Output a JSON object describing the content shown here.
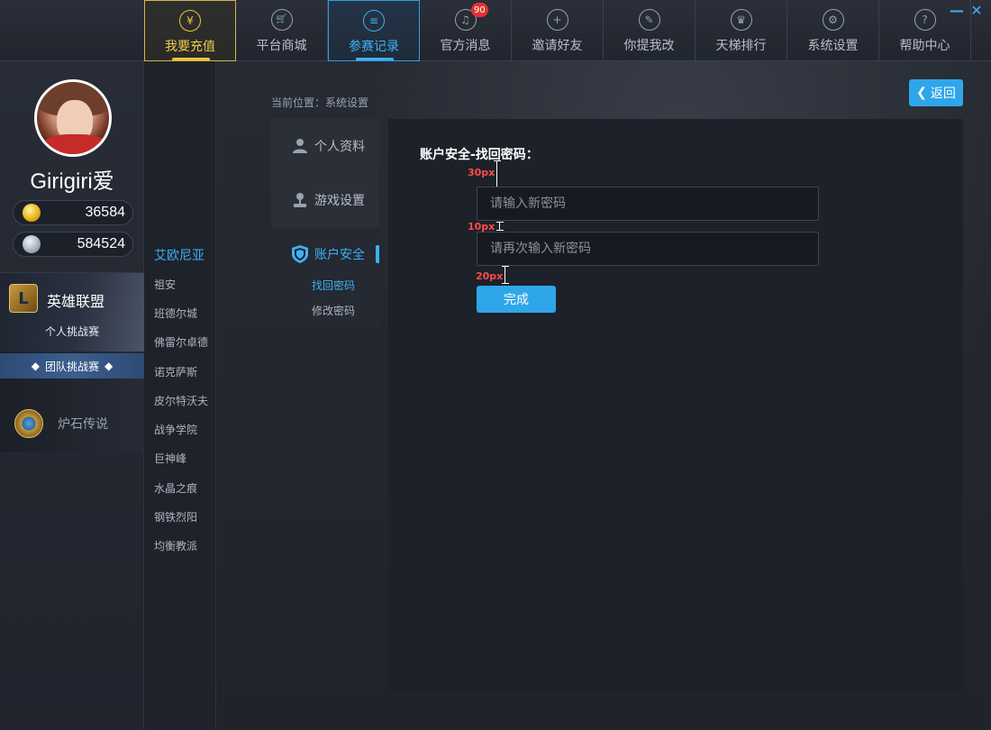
{
  "window": {
    "minimize_icon": "minus-icon",
    "close_icon": "close-icon",
    "minimize_glyph": "—",
    "close_glyph": "✕"
  },
  "nav": {
    "items": [
      {
        "label": "我要充值",
        "icon": "yuan-icon",
        "glyph": "¥"
      },
      {
        "label": "平台商城",
        "icon": "cart-icon",
        "glyph": "🛒"
      },
      {
        "label": "参赛记录",
        "icon": "document-icon",
        "glyph": "≡"
      },
      {
        "label": "官方消息",
        "icon": "bell-icon",
        "glyph": "♫",
        "badge": "90"
      },
      {
        "label": "邀请好友",
        "icon": "add-user-icon",
        "glyph": "+"
      },
      {
        "label": "你提我改",
        "icon": "pencil-icon",
        "glyph": "✎"
      },
      {
        "label": "天梯排行",
        "icon": "trophy-icon",
        "glyph": "♛"
      },
      {
        "label": "系统设置",
        "icon": "gear-icon",
        "glyph": "⚙"
      },
      {
        "label": "帮助中心",
        "icon": "question-icon",
        "glyph": "?"
      }
    ]
  },
  "profile": {
    "username": "Girigiri爱",
    "gold": "36584",
    "silver": "584524"
  },
  "games": {
    "lol": {
      "logo_text": "L",
      "title": "英雄联盟",
      "mode": "个人挑战赛",
      "team_mode": "团队挑战赛"
    },
    "hearthstone": {
      "title": "炉石传说"
    }
  },
  "servers": [
    "艾欧尼亚",
    "祖安",
    "班德尔城",
    "佛雷尔卓德",
    "诺克萨斯",
    "皮尔特沃夫",
    "战争学院",
    "巨神峰",
    "水晶之痕",
    "钢铁烈阳",
    "均衡教派"
  ],
  "breadcrumb": "当前位置：系统设置",
  "back_button": {
    "label": "返回",
    "glyph": "❮"
  },
  "settings_menu": {
    "items": [
      {
        "label": "个人资料",
        "icon": "user-icon"
      },
      {
        "label": "游戏设置",
        "icon": "joystick-icon"
      },
      {
        "label": "账户安全",
        "icon": "shield-icon"
      }
    ],
    "sub_items": [
      "找回密码",
      "修改密码"
    ]
  },
  "form": {
    "title": "账户安全-找回密码：",
    "new_password_placeholder": "请输入新密码",
    "confirm_password_placeholder": "请再次输入新密码",
    "submit_label": "完成"
  },
  "annotations": [
    "30px",
    "10px",
    "20px"
  ],
  "colors": {
    "accent": "#3fb0f2",
    "recharge": "#f2c94c",
    "badge": "#e0322d",
    "annotation": "#ff4a4a"
  }
}
